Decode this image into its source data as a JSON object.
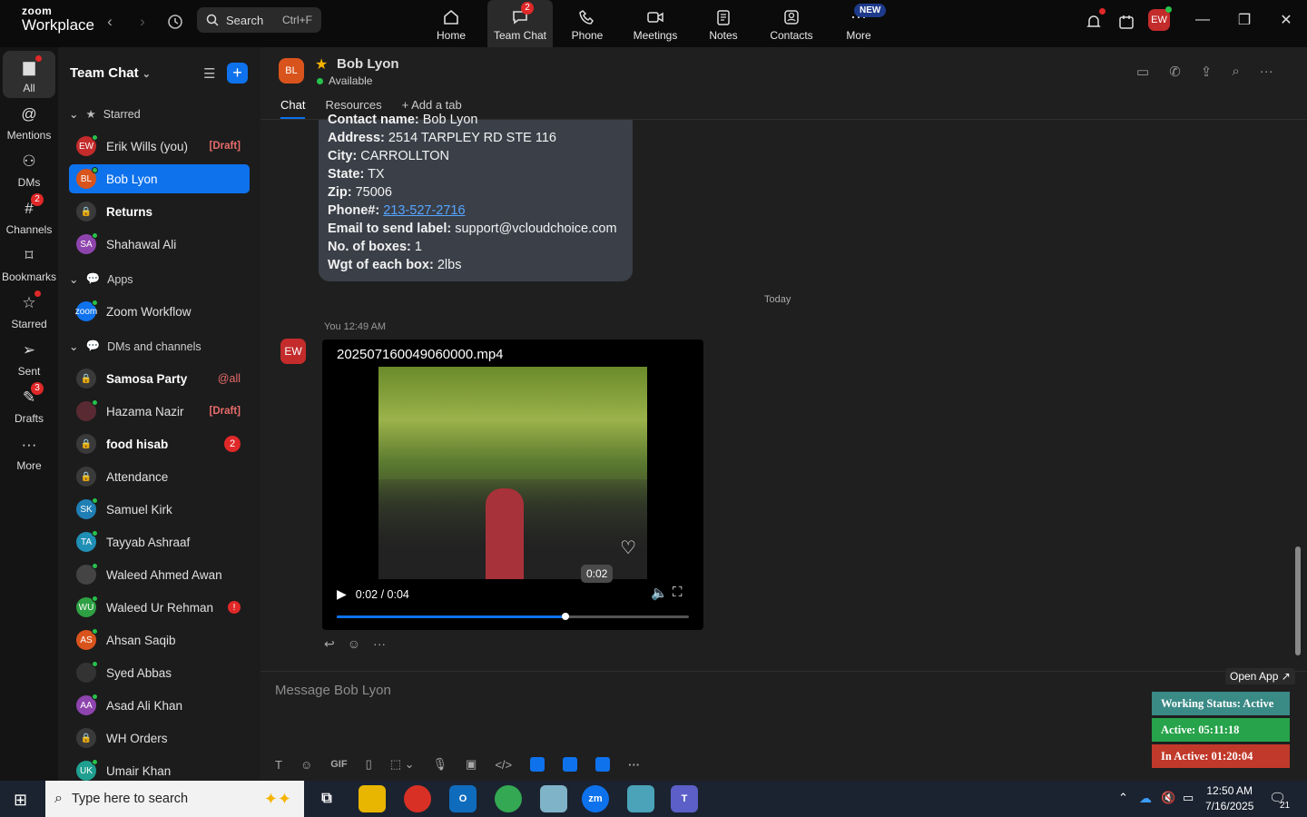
{
  "topbar": {
    "logo_line1": "zoom",
    "logo_line2": "Workplace",
    "search_placeholder": "Search",
    "search_shortcut": "Ctrl+F",
    "nav": [
      {
        "label": "Home",
        "icon": "home-icon"
      },
      {
        "label": "Team Chat",
        "icon": "chat-icon",
        "badge": "2",
        "active": true
      },
      {
        "label": "Phone",
        "icon": "phone-icon"
      },
      {
        "label": "Meetings",
        "icon": "video-icon"
      },
      {
        "label": "Notes",
        "icon": "notes-icon"
      },
      {
        "label": "Contacts",
        "icon": "contacts-icon"
      },
      {
        "label": "More",
        "icon": "more-icon",
        "tag": "NEW"
      }
    ],
    "avatar": "EW"
  },
  "rail": [
    {
      "label": "All",
      "icon": "chat-bubble-icon",
      "active": true
    },
    {
      "label": "Mentions",
      "icon": "at-icon"
    },
    {
      "label": "DMs",
      "icon": "people-icon"
    },
    {
      "label": "Channels",
      "icon": "hash-icon",
      "badge": "2"
    },
    {
      "label": "Bookmarks",
      "icon": "bookmark-icon"
    },
    {
      "label": "Starred",
      "icon": "star-icon"
    },
    {
      "label": "Sent",
      "icon": "send-icon"
    },
    {
      "label": "Drafts",
      "icon": "draft-icon",
      "badge": "3"
    },
    {
      "label": "More",
      "icon": "ellipsis-icon"
    }
  ],
  "sidebar": {
    "title": "Team Chat",
    "sections": {
      "starred": "Starred",
      "apps": "Apps",
      "dms": "DMs and channels"
    },
    "starred": [
      {
        "initials": "EW",
        "name": "Erik Wills (you)",
        "color": "#c42b2b",
        "tag": "[Draft]"
      },
      {
        "initials": "BL",
        "name": "Bob Lyon",
        "color": "#d9541c",
        "selected": true
      },
      {
        "initials": "",
        "name": "Returns",
        "lock": true,
        "bold": true
      },
      {
        "initials": "SA",
        "name": "Shahawal Ali",
        "color": "#8e44ad"
      }
    ],
    "apps": [
      {
        "initials": "zoom",
        "name": "Zoom Workflow",
        "color": "#0e72ed"
      }
    ],
    "dms": [
      {
        "initials": "",
        "name": "Samosa Party",
        "lock": true,
        "bold": true,
        "tag": "@all"
      },
      {
        "initials": "",
        "name": "Hazama Nazir",
        "color": "#5a2a33",
        "tag": "[Draft]"
      },
      {
        "initials": "",
        "name": "food hisab",
        "lock": true,
        "bold": true,
        "count": "2"
      },
      {
        "initials": "",
        "name": "Attendance",
        "lock": true
      },
      {
        "initials": "SK",
        "name": "Samuel Kirk",
        "color": "#1f7fb5"
      },
      {
        "initials": "TA",
        "name": "Tayyab Ashraaf",
        "color": "#1f8fb5"
      },
      {
        "initials": "",
        "name": "Waleed Ahmed Awan",
        "color": "#444"
      },
      {
        "initials": "WU",
        "name": "Waleed Ur Rehman",
        "color": "#2ea043",
        "alert": "!"
      },
      {
        "initials": "AS",
        "name": "Ahsan Saqib",
        "color": "#d9541c"
      },
      {
        "initials": "",
        "name": "Syed Abbas",
        "color": "#333"
      },
      {
        "initials": "AA",
        "name": "Asad Ali Khan",
        "color": "#8e44ad"
      },
      {
        "initials": "",
        "name": "WH Orders",
        "lock": true
      },
      {
        "initials": "UK",
        "name": "Umair Khan",
        "color": "#1f9f8f"
      }
    ]
  },
  "chat": {
    "contact_initials": "BL",
    "contact_name": "Bob Lyon",
    "status": "Available",
    "tabs": [
      "Chat",
      "Resources",
      "+ Add a tab"
    ],
    "prev_message": [
      {
        "label": "Contact name:",
        "value": "Bob Lyon"
      },
      {
        "label": "Address:",
        "value": "2514 TARPLEY RD STE 116"
      },
      {
        "label": "City:",
        "value": "CARROLLTON"
      },
      {
        "label": "State:",
        "value": "TX"
      },
      {
        "label": "Zip:",
        "value": "75006"
      },
      {
        "label": "Phone#:",
        "value": "213-527-2716",
        "link": true
      },
      {
        "label": "Email to send label:",
        "value": "support@vcloudchoice.com"
      },
      {
        "label": "No. of boxes:",
        "value": "1"
      },
      {
        "label": "Wgt of each box:",
        "value": "2lbs"
      }
    ],
    "date_divider": "Today",
    "message_meta": "You 12:49 AM",
    "sender_initials": "EW",
    "video": {
      "filename": "202507160049060000.mp4",
      "time": "0:02 / 0:04",
      "tooltip": "0:02",
      "progress": 0.65
    },
    "composer_placeholder": "Message Bob Lyon"
  },
  "widget": {
    "open_app": "Open App ↗",
    "working_status": "Working Status: Active",
    "active": "Active: 05:11:18",
    "inactive": "In Active: 01:20:04",
    "colors": {
      "status": "#3a8a86",
      "active": "#27a34b",
      "inactive": "#c0392b"
    }
  },
  "taskbar": {
    "search_placeholder": "Type here to search",
    "time": "12:50 AM",
    "date": "7/16/2025",
    "notif_count": "21"
  }
}
